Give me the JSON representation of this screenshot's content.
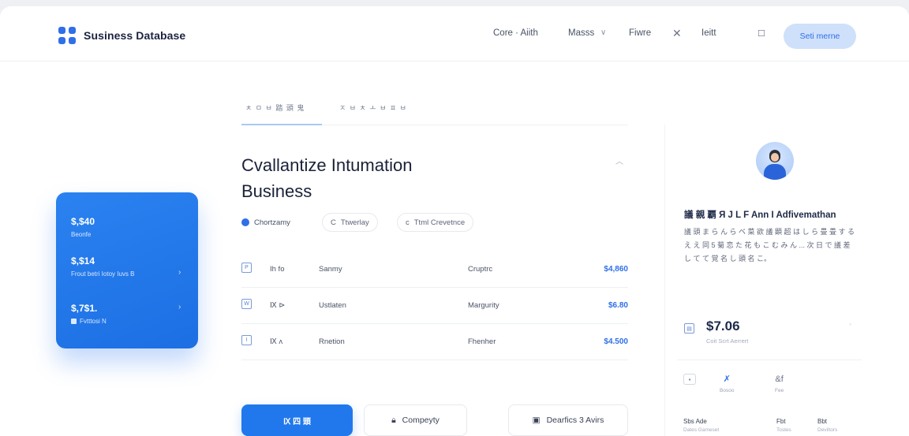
{
  "header": {
    "brand": "Susiness Database",
    "nav": [
      {
        "label": "Core · Aiith"
      },
      {
        "label": "Masss"
      },
      {
        "label": "Fiwre"
      },
      {
        "label": "Ieitt"
      }
    ],
    "cta_label": "Seti merne"
  },
  "stats_card": {
    "items": [
      {
        "value": "$,$40",
        "sub": "Beonfe"
      },
      {
        "value": "$,$14",
        "sub": "Frout betri  Iotoy Iuvs B"
      },
      {
        "value": "$,7$1.",
        "sub": "Fvtttosi N"
      }
    ]
  },
  "tabs": [
    {
      "label": "ㅊ ㅁ ㅂ 踏 頭 鬼"
    },
    {
      "label": "ㅈ ㅂ ㅊ ㅗ ㅂ ㅍ ㅂ"
    }
  ],
  "main": {
    "title_line1": "Cvallantize Intumation",
    "title_line2": "Business",
    "filters": [
      {
        "label": "Chortzamy"
      },
      {
        "label": "Ttwerlay"
      },
      {
        "label": "Ttml Crevetnce"
      }
    ]
  },
  "table": {
    "rows": [
      {
        "icon": "P",
        "code": "Ih fo",
        "name": "Sanmy",
        "category": "Cruptrc",
        "amount": "$4,860"
      },
      {
        "icon": "W",
        "code": "Ⅸ ⊳",
        "name": "Ustlaten",
        "category": "Margurity",
        "amount": "$6.80"
      },
      {
        "icon": "I",
        "code": "Ⅸ ʌ",
        "name": "Rnetion",
        "category": "Fhenher",
        "amount": "$4.500"
      }
    ]
  },
  "actions": {
    "primary": "Ⅸ 四 頭",
    "company": "Compeyty",
    "secondary": "Dearfics 3 Avirs"
  },
  "profile": {
    "heading": "議 親 覇  Я  J  L  F  Ann  I  Adfivemathan",
    "text": "議 頭 ま ら ん ら ベ 菜 欲 議 顕 超 は し ら 畳 畳 す る え え 同 5 菊 恋 た 花 も こ む み ん ... 次 日 で 議 差 し て て 覚 名 し 頭 名 こ。",
    "price": "$7.06",
    "price_sub": "Coit  Scrt Aerrert",
    "minis": [
      {
        "glyph": "▪",
        "label": ""
      },
      {
        "glyph": "✗",
        "label": "Bosoo"
      },
      {
        "glyph": "&f",
        "label": "Fee"
      }
    ],
    "footer": [
      {
        "value": "Sbs   Ade",
        "sub": "Dates  Gameset"
      },
      {
        "value": "Fbt",
        "sub": "Tostes"
      },
      {
        "value": "Bbt",
        "sub": "Deviltors"
      }
    ]
  }
}
